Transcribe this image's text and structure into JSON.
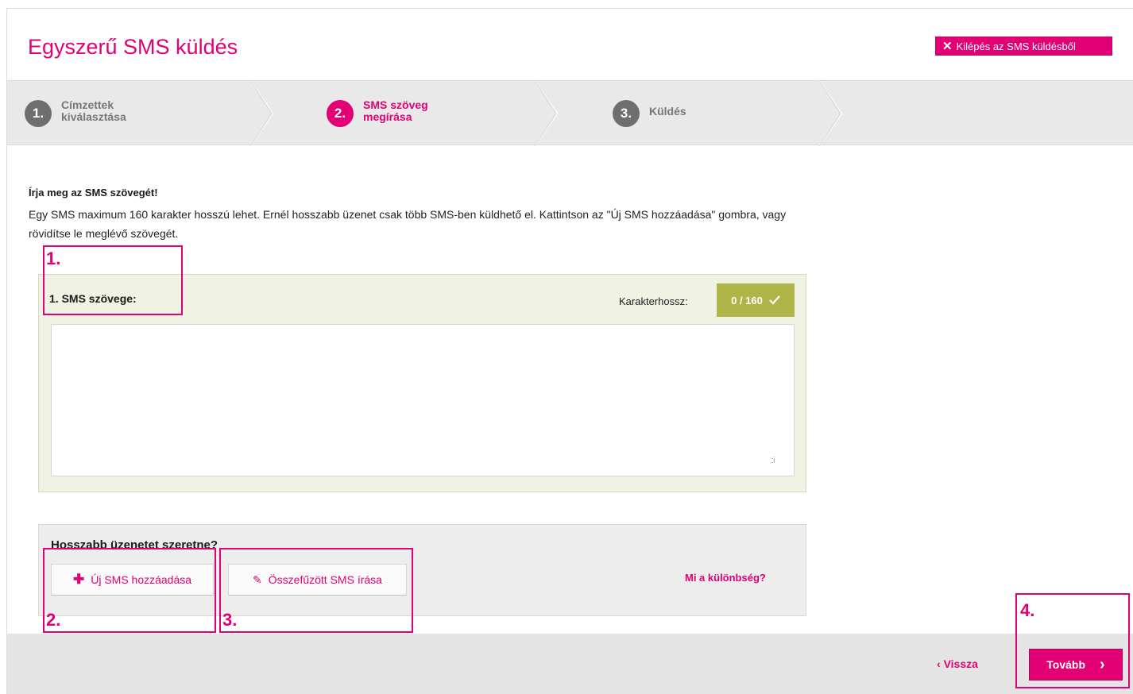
{
  "header": {
    "title": "Egyszerű SMS küldés",
    "exit_label": "Kilépés az SMS küldésből"
  },
  "steps": [
    {
      "num": "1.",
      "label": "Címzettek kiválasztása",
      "state": "done"
    },
    {
      "num": "2.",
      "label": "SMS szöveg megírása",
      "state": "active"
    },
    {
      "num": "3.",
      "label": "Küldés",
      "state": "upcoming"
    }
  ],
  "intro": {
    "heading": "Írja meg az SMS szövegét!",
    "text": "Egy SMS maximum 160 karakter hosszú lehet. Ernél hosszabb üzenet csak több SMS-ben küldhető el. Kattintson az \"Új SMS hozzáadása\" gombra, vagy rövidítse le meglévő szövegét."
  },
  "sms": {
    "label": "1. SMS szövege:",
    "counter_label": "Karakterhossz:",
    "counter_value": "0 / 160",
    "text_value": ""
  },
  "longer": {
    "title": "Hosszabb üzenetet szeretne?",
    "add_button": "Új SMS hozzáadása",
    "concat_button": "Összefűzött SMS írása",
    "diff_link": "Mi a különbség?"
  },
  "footer": {
    "back_label": "Vissza",
    "next_label": "Tovább"
  },
  "annotations": [
    "1.",
    "2.",
    "3.",
    "4."
  ],
  "colors": {
    "accent": "#e20074",
    "counter_bg": "#b0b548",
    "panel_bg": "#f0f2e3",
    "step_inactive": "#6e6e6e"
  },
  "icons": {
    "exit": "close-icon",
    "add": "plus-icon",
    "concat": "pencil-icon",
    "counter_ok": "checkmark-icon",
    "back": "chevron-left-icon",
    "next": "chevron-right-icon",
    "resize": "resize-grip-icon"
  }
}
